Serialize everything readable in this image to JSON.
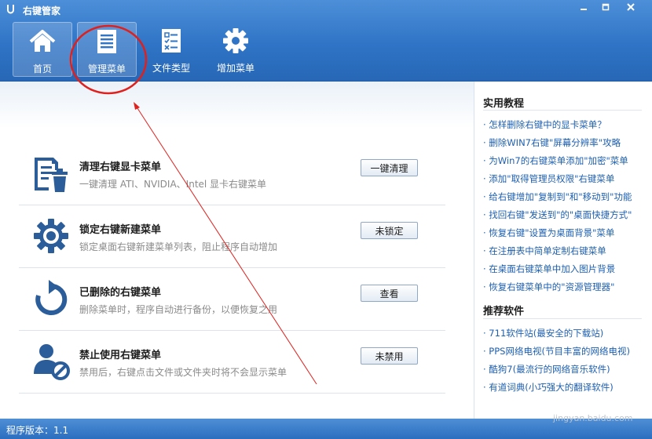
{
  "window": {
    "title": "右键管家"
  },
  "toolbar": [
    {
      "label": "首页",
      "icon": "home-icon"
    },
    {
      "label": "管理菜单",
      "icon": "menu-list-icon"
    },
    {
      "label": "文件类型",
      "icon": "file-type-icon"
    },
    {
      "label": "增加菜单",
      "icon": "gear-icon"
    }
  ],
  "rows": [
    {
      "title": "清理右键显卡菜单",
      "desc": "一键清理 ATI、NVIDIA、Intel 显卡右键菜单",
      "button": "一键清理",
      "icon": "clean-document-icon"
    },
    {
      "title": "锁定右键新建菜单",
      "desc": "锁定桌面右键新建菜单列表，阻止程序自动增加",
      "button": "未锁定",
      "icon": "gear-icon"
    },
    {
      "title": "已删除的右键菜单",
      "desc": "删除菜单时，程序自动进行备份，以便恢复之用",
      "button": "查看",
      "icon": "refresh-icon"
    },
    {
      "title": "禁止使用右键菜单",
      "desc": "禁用后，右键点击文件或文件夹时将不会显示菜单",
      "button": "未禁用",
      "icon": "user-block-icon"
    }
  ],
  "sidebar": {
    "tutorials_title": "实用教程",
    "tutorials": [
      "· 怎样删除右键中的显卡菜单？",
      "· 删除WIN7右键\"屏幕分辨率\"攻略",
      "· 为Win7的右键菜单添加\"加密\"菜单",
      "· 添加\"取得管理员权限\"右键菜单",
      "· 给右键增加\"复制到\"和\"移动到\"功能",
      "· 找回右键\"发送到\"的\"桌面快捷方式\"",
      "· 恢复右键\"设置为桌面背景\"菜单",
      "· 在注册表中简单定制右键菜单",
      "· 在桌面右键菜单中加入图片背景",
      "· 恢复右键菜单中的\"资源管理器\""
    ],
    "software_title": "推荐软件",
    "software": [
      "· 711软件站(最安全的下载站)",
      "· PPS网络电视(节目丰富的网络电视)",
      "· 酷狗7(最流行的网络音乐软件)",
      "· 有道词典(小巧强大的翻译软件)"
    ]
  },
  "status": {
    "version": "程序版本：1.1"
  },
  "watermark": "jingyan.baidu.com",
  "colors": {
    "header": "#2f74c6",
    "icon": "#2a5d9a",
    "annotation": "#e0201c"
  }
}
